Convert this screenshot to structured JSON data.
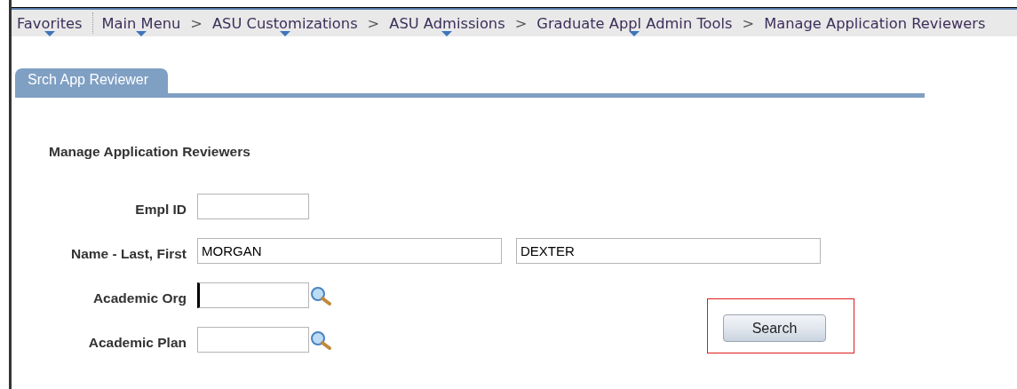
{
  "nav": {
    "favorites": {
      "label": "Favorites",
      "has_menu": true
    },
    "separator": ">",
    "breadcrumb": [
      {
        "label": "Main Menu",
        "has_menu": true
      },
      {
        "label": "ASU Customizations",
        "has_menu": true
      },
      {
        "label": "ASU Admissions",
        "has_menu": true
      },
      {
        "label": "Graduate Appl Admin Tools",
        "has_menu": true
      },
      {
        "label": "Manage Application Reviewers",
        "has_menu": false
      }
    ]
  },
  "tabs": [
    {
      "label": "Srch App Reviewer",
      "selected": true
    }
  ],
  "heading": "Manage Application Reviewers",
  "form": [
    {
      "label": "Empl ID",
      "fields": [
        {
          "kind": "text",
          "focused": false
        }
      ]
    },
    {
      "label": "Name - Last, First",
      "fields": [
        {
          "kind": "wide_text",
          "value": "MORGAN",
          "focused": false
        },
        {
          "kind": "wide_text",
          "value": "DEXTER",
          "focused": false
        }
      ]
    },
    {
      "label": "Academic Org",
      "fields": [
        {
          "kind": "lookup",
          "focused": true
        }
      ]
    },
    {
      "label": "Academic Plan",
      "fields": [
        {
          "kind": "lookup",
          "focused": false
        }
      ]
    }
  ],
  "search_button": {
    "label": "Search",
    "highlighted": true
  }
}
